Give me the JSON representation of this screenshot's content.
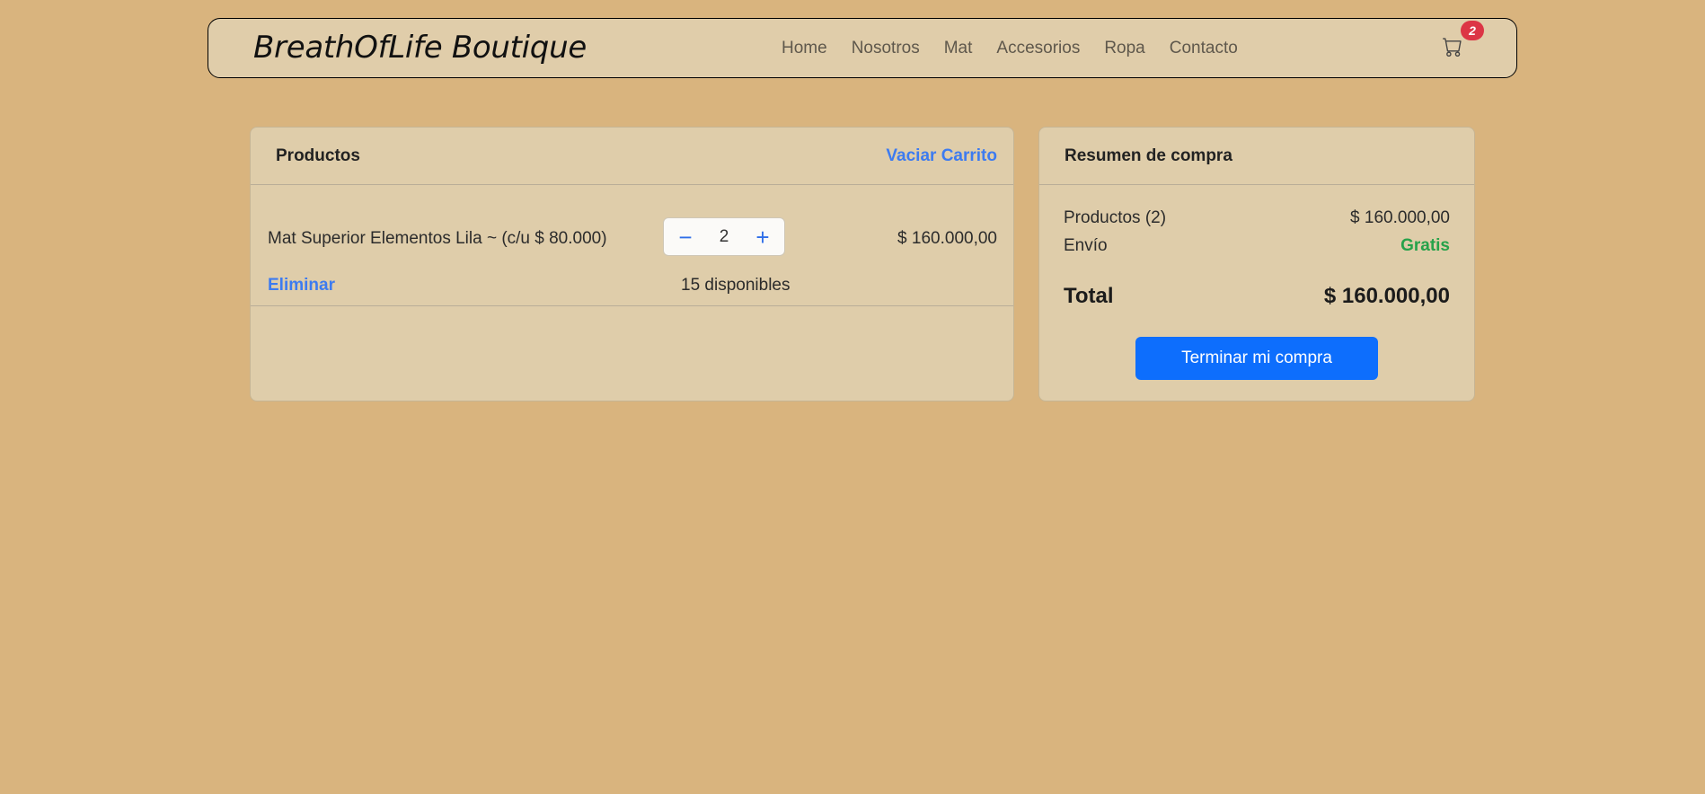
{
  "navbar": {
    "brand": "BreathOfLife Boutique",
    "links": [
      "Home",
      "Nosotros",
      "Mat",
      "Accesorios",
      "Ropa",
      "Contacto"
    ],
    "cart_icon": "cart-icon",
    "cart_count": "2"
  },
  "products": {
    "title": "Productos",
    "clear_label": "Vaciar Carrito",
    "items": [
      {
        "name": "Mat Superior Elementos Lila ~ (c/u $ 80.000)",
        "quantity": "2",
        "minus": "−",
        "plus": "+",
        "subtotal": "$ 160.000,00",
        "remove_label": "Eliminar",
        "available": "15 disponibles"
      }
    ]
  },
  "summary": {
    "title": "Resumen de compra",
    "products_label": "Productos (2)",
    "products_value": "$ 160.000,00",
    "shipping_label": "Envío",
    "shipping_value": "Gratis",
    "total_label": "Total",
    "total_value": "$ 160.000,00",
    "checkout_label": "Terminar mi compra"
  },
  "colors": {
    "background": "#d9b47e",
    "card": "#dfcdaa",
    "accent": "#0d6efd",
    "badge": "#dc3545",
    "free": "#26a24a"
  }
}
